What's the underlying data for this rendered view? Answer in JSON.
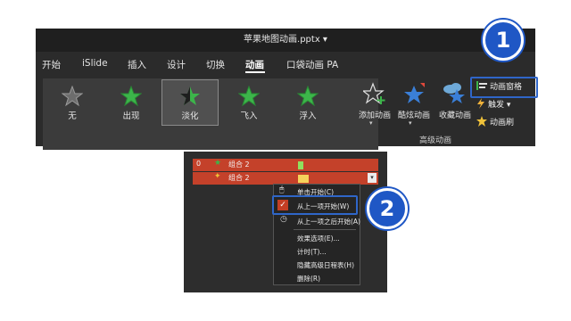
{
  "window": {
    "title": "苹果地图动画.pptx ▾"
  },
  "tabs": [
    "开始",
    "iSlide",
    "插入",
    "设计",
    "切换",
    "动画",
    "口袋动画 PA"
  ],
  "animations": [
    "无",
    "出现",
    "淡化",
    "飞入",
    "浮入"
  ],
  "ribbon_buttons": {
    "add_animation": "添加动画",
    "fancy_animation": "酷炫动画",
    "favorite_animation": "收藏动画",
    "animation_pane": "动画窗格",
    "trigger": "触发 ▾",
    "animation_painter": "动画刷",
    "group_label": "高级动画"
  },
  "callouts": {
    "step1": "1",
    "step2": "2"
  },
  "pane_rows": [
    {
      "index": "0",
      "name": "组合 2"
    },
    {
      "index": "",
      "name": "组合 2"
    }
  ],
  "context_menu": [
    "单击开始(C)",
    "从上一项开始(W)",
    "从上一项之后开始(A)",
    "效果选项(E)...",
    "计时(T)...",
    "隐藏高级日程表(H)",
    "删除(R)"
  ],
  "colors": {
    "accent_blue": "#1f57c5",
    "star_green": "#3cb54a",
    "star_blue": "#3a7fd8",
    "row_red": "#c4412a"
  }
}
